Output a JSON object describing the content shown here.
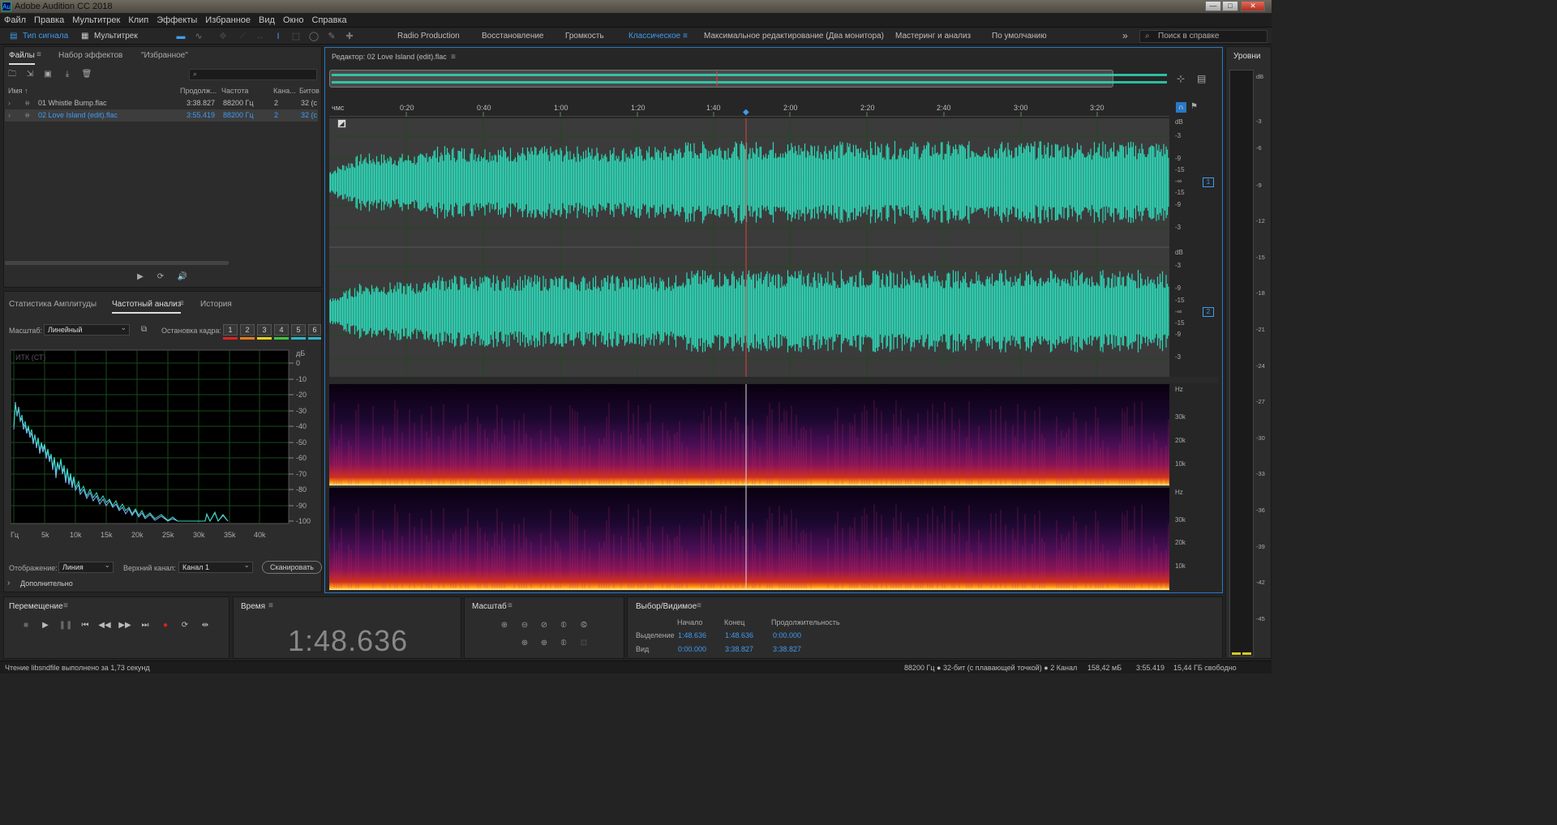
{
  "window": {
    "title": "Adobe Audition CC 2018",
    "icon_text": "Au",
    "minimize": "—",
    "maximize": "□",
    "close": "✕"
  },
  "menu": [
    "Файл",
    "Правка",
    "Мультитрек",
    "Клип",
    "Эффекты",
    "Избранное",
    "Вид",
    "Окно",
    "Справка"
  ],
  "toolbar": {
    "mode_waveform": "Тип сигнала",
    "mode_multitrack": "Мультитрек",
    "workspaces": [
      "Radio Production",
      "Восстановление",
      "Громкость",
      "Классическое",
      "Максимальное редактирование (Два монитора)",
      "Мастеринг и анализ",
      "По умолчанию"
    ],
    "active_workspace": "Классическое",
    "more": "»",
    "search_placeholder": "Поиск в справке"
  },
  "files_panel": {
    "tabs": [
      "Файлы",
      "Набор эффектов",
      "\"Избранное\""
    ],
    "active_tab": "Файлы",
    "columns": [
      "Имя",
      "Продолж...",
      "Частота",
      "Кана...",
      "Битов"
    ],
    "rows": [
      {
        "name": "01 Whistle Bump.flac",
        "duration": "3:38.827",
        "rate": "88200 Гц",
        "channels": "2",
        "bits": "32 (с",
        "selected": false
      },
      {
        "name": "02 Love Island (edit).flac",
        "duration": "3:55.419",
        "rate": "88200 Гц",
        "channels": "2",
        "bits": "32 (с",
        "selected": true
      }
    ]
  },
  "analysis_panel": {
    "tabs": [
      "Статистика Амплитуды",
      "Частотный анализ",
      "История"
    ],
    "active_tab": "Частотный анализ",
    "scale_label": "Масштаб:",
    "scale_value": "Линейный",
    "hold_label": "Остановка кадра:",
    "hold_slots": [
      "1",
      "2",
      "3",
      "4",
      "5",
      "6"
    ],
    "hold_colors": [
      "#e02020",
      "#e87a1a",
      "#e8d21a",
      "#3cc63c",
      "#2bb5c9",
      "#2bb5c9"
    ],
    "graph_label": "ИТК (СТ)",
    "y_unit": "дБ",
    "y_ticks": [
      "0",
      "-10",
      "-20",
      "-30",
      "-40",
      "-50",
      "-60",
      "-70",
      "-80",
      "-90",
      "-100"
    ],
    "x_ticks": [
      "Гц",
      "5k",
      "10k",
      "15k",
      "20k",
      "25k",
      "30k",
      "35k",
      "40k"
    ],
    "display_label": "Отображение:",
    "display_value": "Линия",
    "channel_label": "Верхний канал:",
    "channel_value": "Канал 1",
    "scan_button": "Сканировать",
    "advanced": "Дополнительно"
  },
  "editor": {
    "title": "Редактор: 02 Love Island (edit).flac",
    "ruler_unit": "чмс",
    "ruler_ticks": [
      "0:20",
      "0:40",
      "1:00",
      "1:20",
      "1:40",
      "2:00",
      "2:20",
      "2:40",
      "3:00",
      "3:20"
    ],
    "playhead_time": "1:48.636",
    "db_ticks": [
      "dB",
      "-3",
      "-9",
      "-15",
      "-∞",
      "-15",
      "-9",
      "-3"
    ],
    "channel1": "1",
    "channel2": "2",
    "hz_ticks": [
      "Hz",
      "30k",
      "20k",
      "10k"
    ],
    "waveform_color": "#2ed8b8",
    "playhead_color": "#e04040"
  },
  "levels": {
    "title": "Уровни",
    "ticks": [
      "dB",
      "-3",
      "-6",
      "-9",
      "-12",
      "-15",
      "-18",
      "-21",
      "-24",
      "-27",
      "-30",
      "-33",
      "-36",
      "-39",
      "-42",
      "-45"
    ]
  },
  "transport": {
    "title": "Перемещение",
    "buttons": [
      "■",
      "▶",
      "❚❚",
      "⏮",
      "◀◀",
      "▶▶",
      "⏭",
      "●",
      "⟳",
      "⇹"
    ]
  },
  "time_panel": {
    "title": "Время",
    "value": "1:48.636"
  },
  "zoom_panel": {
    "title": "Масштаб"
  },
  "selection_panel": {
    "title": "Выбор/Видимое",
    "columns": [
      "Начало",
      "Конец",
      "Продолжительность"
    ],
    "rows": [
      {
        "label": "Выделение",
        "start": "1:48.636",
        "end": "1:48.636",
        "duration": "0:00.000"
      },
      {
        "label": "Вид",
        "start": "0:00.000",
        "end": "3:38.827",
        "duration": "3:38.827"
      }
    ]
  },
  "status": {
    "message": "Чтение libsndfile выполнено за 1,73 секунд",
    "format": "88200 Гц ● 32-бит (с плавающей точкой) ● 2 Канал",
    "size": "158,42 мБ",
    "duration": "3:55.419",
    "free": "15,44 ГБ свободно"
  }
}
